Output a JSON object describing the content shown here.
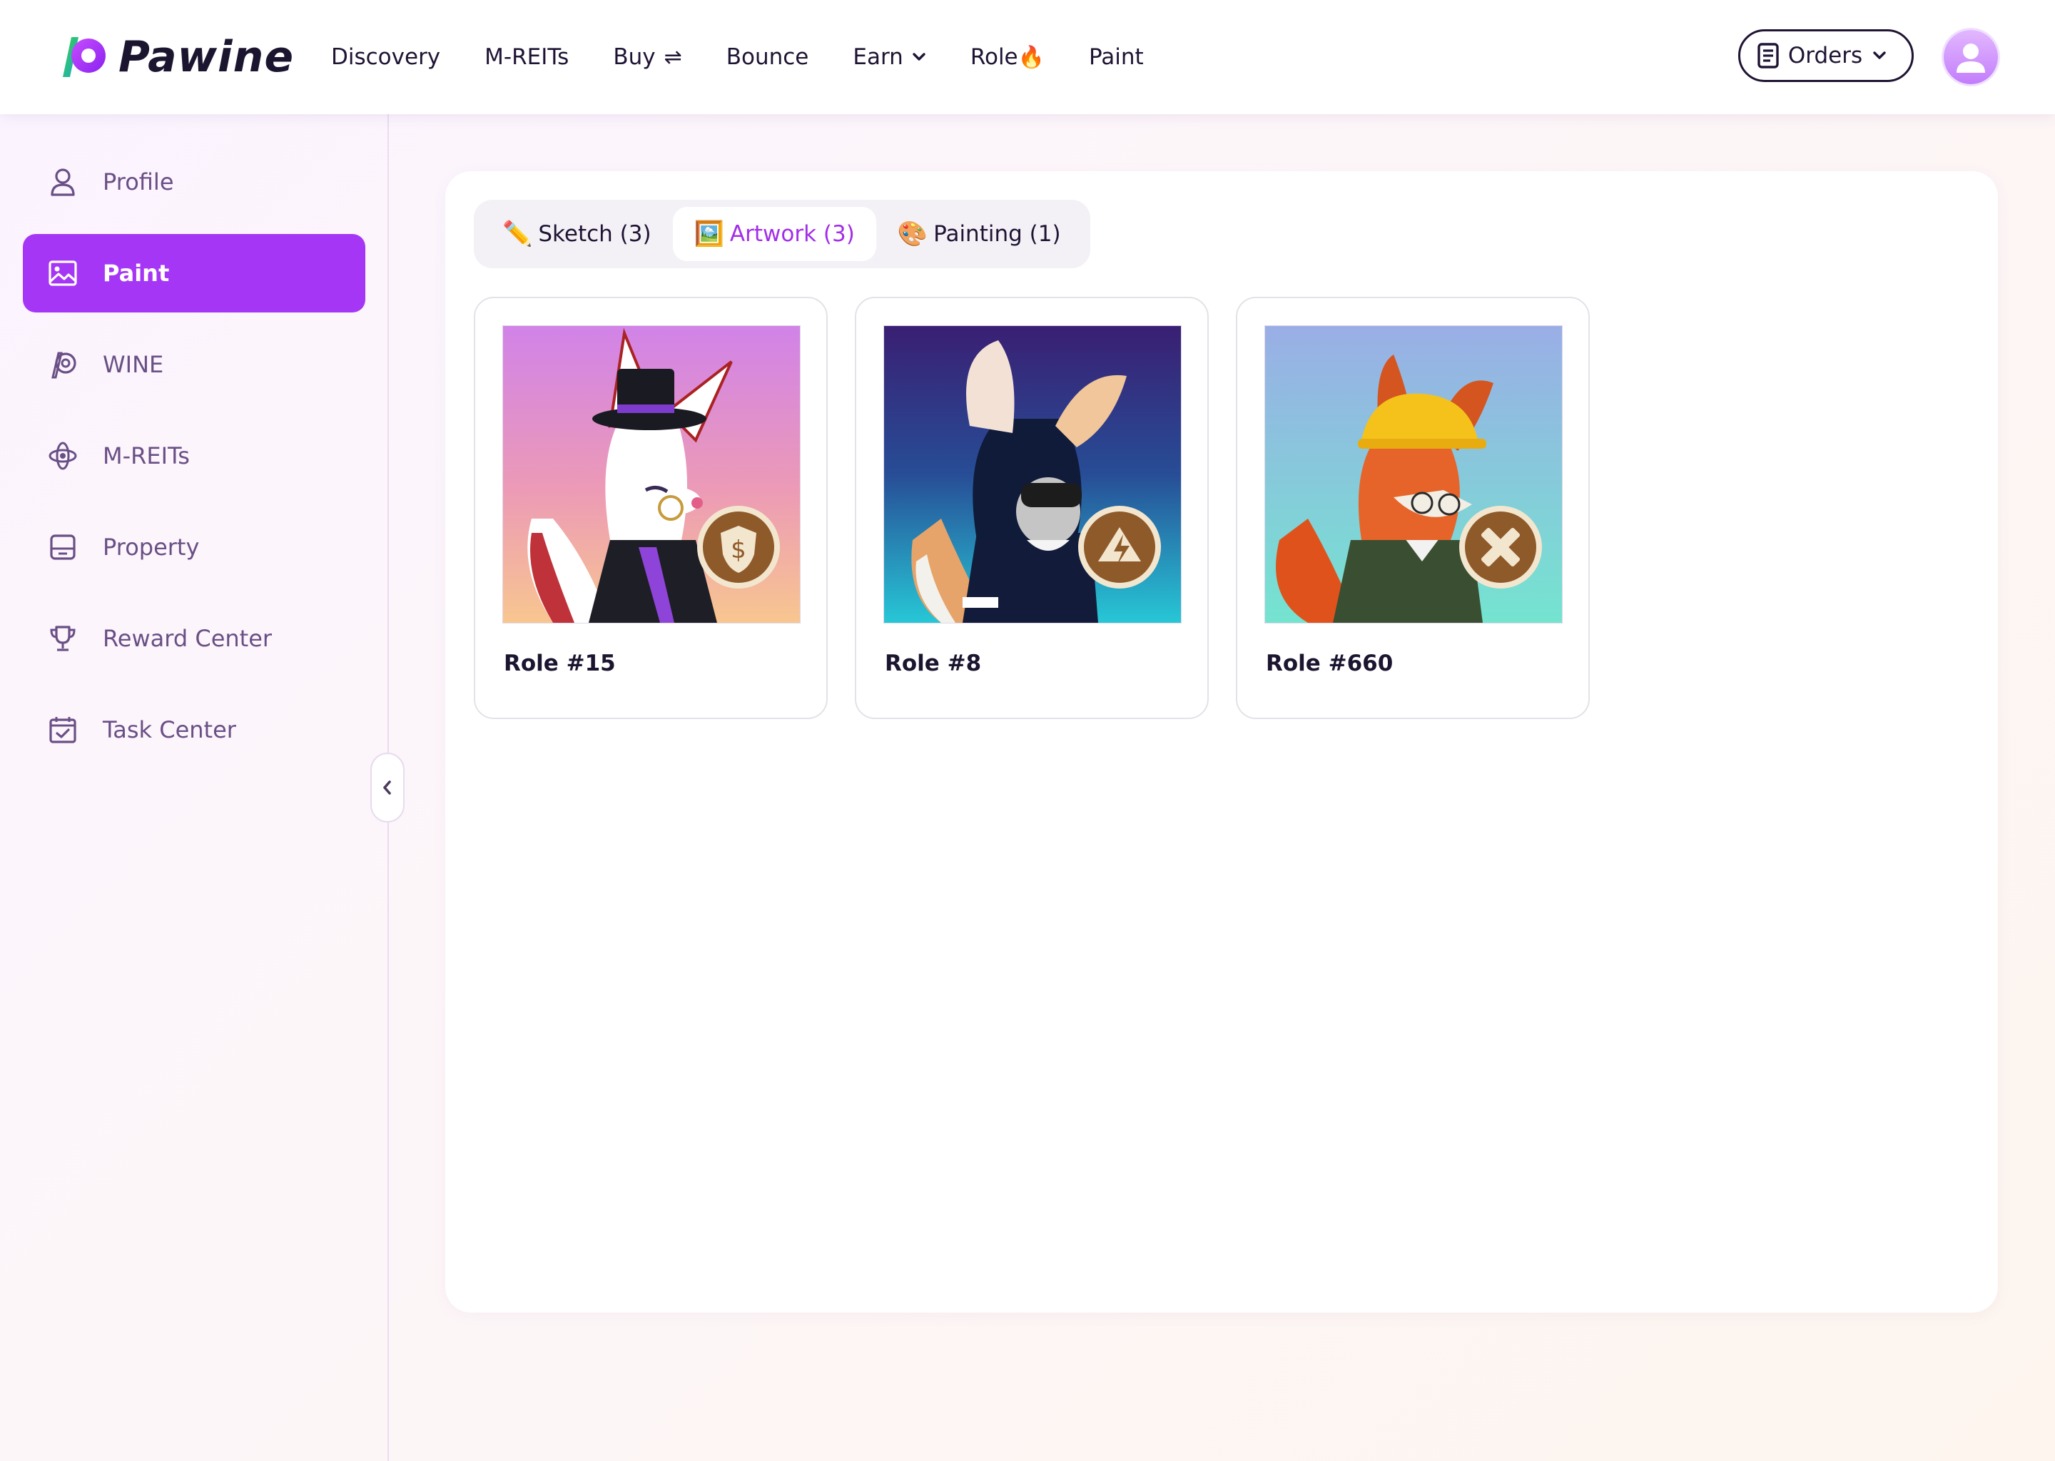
{
  "brand": {
    "name": "Pawine"
  },
  "nav": {
    "items": [
      {
        "label": "Discovery"
      },
      {
        "label": "M-REITs"
      },
      {
        "label": "Buy",
        "icon": "swap-arrows-icon",
        "glyph": "⇌"
      },
      {
        "label": "Bounce"
      },
      {
        "label": "Earn",
        "icon": "chevron-down-icon"
      },
      {
        "label": "Role",
        "icon": "fire-icon",
        "glyph": "🔥"
      },
      {
        "label": "Paint"
      }
    ],
    "orders_label": "Orders"
  },
  "sidebar": {
    "items": [
      {
        "label": "Profile",
        "icon": "user-icon"
      },
      {
        "label": "Paint",
        "icon": "image-icon",
        "active": true
      },
      {
        "label": "WINE",
        "icon": "wine-token-icon"
      },
      {
        "label": "M-REITs",
        "icon": "orbit-icon"
      },
      {
        "label": "Property",
        "icon": "archive-box-icon"
      },
      {
        "label": "Reward Center",
        "icon": "trophy-icon"
      },
      {
        "label": "Task Center",
        "icon": "calendar-check-icon"
      }
    ]
  },
  "tabs": [
    {
      "emoji": "✏️",
      "label": "Sketch (3)"
    },
    {
      "emoji": "🖼️",
      "label": "Artwork (3)",
      "active": true
    },
    {
      "emoji": "🎨",
      "label": "Painting (1)"
    }
  ],
  "cards": [
    {
      "title": "Role #15",
      "image": "white-fox-top-hat-artwork",
      "badge": "dollar-shield-badge-icon"
    },
    {
      "title": "Role #8",
      "image": "hooded-fox-goggles-artwork",
      "badge": "lightning-crest-badge-icon"
    },
    {
      "title": "Role #660",
      "image": "red-fox-hard-hat-artwork",
      "badge": "crossed-tools-badge-icon"
    }
  ],
  "colors": {
    "accent": "#a636f5",
    "accent_text": "#a32ee8",
    "sidebar_text": "#6a4f86"
  }
}
